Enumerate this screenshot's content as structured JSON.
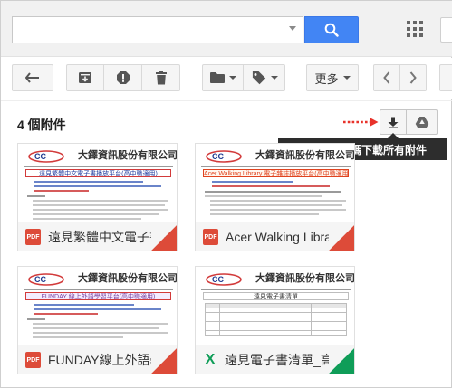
{
  "search": {
    "value": "",
    "placeholder": ""
  },
  "header": {
    "search_icon": "search-icon",
    "apps_icon": "apps-grid-icon"
  },
  "toolbar": {
    "back_icon": "back-arrow-icon",
    "archive_icon": "archive-icon",
    "spam_icon": "report-spam-icon",
    "delete_icon": "trash-icon",
    "move_icon": "folder-icon",
    "labels_icon": "label-icon",
    "more_label": "更多",
    "prev_icon": "chevron-left-icon",
    "next_icon": "chevron-right-icon"
  },
  "attachments": {
    "count_label": "4 個附件",
    "download_all_icon": "download-icon",
    "save_to_drive_icon": "google-drive-icon",
    "tooltip": "使用指定的編碼下載所有附件",
    "items": [
      {
        "name": "遠見繁體中文電子書平台",
        "type_label": "PDF",
        "thumb": {
          "brand": "大鐸資訊股份有限公司",
          "title": "遠見繁體中文電子書播放平台(高中職適用)"
        }
      },
      {
        "name": "Acer Walking Library",
        "type_label": "PDF",
        "thumb": {
          "brand": "大鐸資訊股份有限公司",
          "title": "Acer Walking Library 電子雜誌播放平台(高中職適用)"
        }
      },
      {
        "name": "FUNDAY線上外語學習平台",
        "type_label": "PDF",
        "thumb": {
          "brand": "大鐸資訊股份有限公司",
          "title": "FUNDAY 線上外語學習平台(高中職適用)"
        }
      },
      {
        "name": "遠見電子書清單_高中職",
        "type_label": "X",
        "thumb": {
          "brand": "大鐸資訊股份有限公司",
          "title": "遠見電子書清單"
        }
      }
    ]
  },
  "colors": {
    "search_blue": "#4285f4",
    "pdf_red": "#dd4b39",
    "sheet_green": "#0f9d58",
    "tooltip_bg": "#2d2d2d",
    "hint_arrow_red": "#e8322a"
  }
}
